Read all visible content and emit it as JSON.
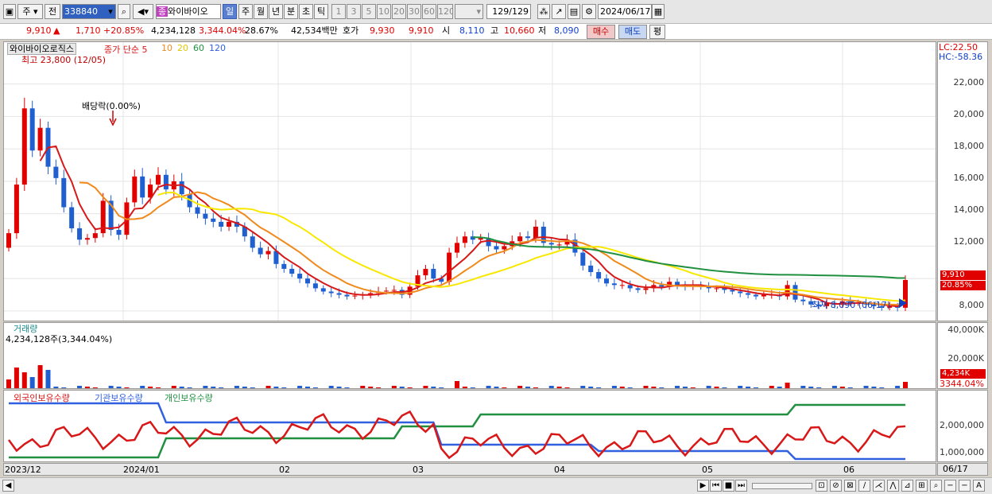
{
  "toolbar": {
    "b1": "주",
    "b2": "전",
    "code": "338840",
    "name": "와이바이오",
    "name_tag": "종",
    "periods": [
      "일",
      "주",
      "월",
      "년",
      "분",
      "초",
      "틱"
    ],
    "nums": [
      "1",
      "3",
      "5",
      "10",
      "20",
      "30",
      "60",
      "120"
    ],
    "count": "129",
    "count_total": "/129",
    "date": "2024/06/17"
  },
  "quote": {
    "price": "9,910",
    "arrow": "▲",
    "change": "1,710",
    "pct": "+20.85%",
    "volume": "4,234,128",
    "vol_pct": "3,344.04%",
    "turnover": "28.67%",
    "amount": "42,534백만",
    "hoga": "호가",
    "hoga1": "9,930",
    "hoga2": "9,910",
    "open_l": "시",
    "open": "8,110",
    "high_l": "고",
    "high": "10,660",
    "low_l": "저",
    "low": "8,090",
    "buy": "매수",
    "sell": "매도",
    "avg": "평"
  },
  "main": {
    "legend_name": "와이바이오로직스",
    "legend_close": "종가 단순 5",
    "ma": [
      "10",
      "20",
      "60",
      "120"
    ],
    "high_note": "최고 23,800 (12/05)",
    "low_note": "최저 8,090 (06/17)",
    "div_note": "배당락(0.00%)",
    "lc": "LC:22.50",
    "hc": "HC:-58.36",
    "ticks": [
      "22,000",
      "20,000",
      "18,000",
      "16,000",
      "14,000",
      "12,000",
      "9,910",
      "8,000"
    ],
    "price_tag": "9,910",
    "pct_tag": "20.85%"
  },
  "volume": {
    "title": "거래량",
    "value": "4,234,128주(3,344.04%)",
    "ticks": [
      "40,000K",
      "20,000K"
    ],
    "tag1": "4,234K",
    "tag2": "3344.04%"
  },
  "holders": {
    "legend": [
      "외국인보유수량",
      "기관보유수량",
      "개인보유수량"
    ],
    "ticks": [
      "2,000,000",
      "1,000,000"
    ]
  },
  "dates": {
    "labels": [
      "2023/12",
      "2024/01",
      "02",
      "03",
      "04",
      "05",
      "06"
    ],
    "last": "06/17"
  },
  "colors": {
    "up": "#e00000",
    "down": "#1f5fcf",
    "ma5": "#d81818",
    "ma10": "#f08a1c",
    "ma20": "#f8e800",
    "ma60": "#209040",
    "ma120": "#3060e0"
  },
  "chart_data": {
    "type": "candlestick",
    "title": "와이바이오로직스",
    "period": "daily",
    "range": [
      "2023/12",
      "2024/06/17"
    ],
    "ylim": [
      7800,
      23800
    ],
    "closes": [
      12800,
      15800,
      20500,
      17900,
      19300,
      16900,
      16200,
      14400,
      13100,
      12400,
      12500,
      12800,
      14800,
      13000,
      12700,
      14700,
      16300,
      15000,
      15800,
      16400,
      15500,
      16000,
      15200,
      14400,
      14000,
      13700,
      13500,
      13200,
      13500,
      13200,
      12600,
      11900,
      11500,
      11700,
      10900,
      10600,
      10300,
      10000,
      9700,
      9400,
      9200,
      9100,
      9000,
      8900,
      8950,
      9000,
      9100,
      9200,
      9250,
      9300,
      9000,
      9500,
      10200,
      10600,
      10000,
      9800,
      11600,
      12200,
      12600,
      12400,
      12500,
      12000,
      11800,
      12000,
      12300,
      12600,
      12500,
      13200,
      12200,
      12100,
      12100,
      12400,
      11600,
      10800,
      10400,
      10000,
      9700,
      9600,
      9600,
      9400,
      9300,
      9400,
      9600,
      9500,
      9800,
      9600,
      9500,
      9600,
      9500,
      9400,
      9400,
      9300,
      9200,
      9100,
      9000,
      8900,
      9000,
      9000,
      8900,
      9600,
      8700,
      8600,
      8400,
      8300,
      8500,
      8400,
      8600,
      8500,
      8500,
      8400,
      8300,
      8200,
      8300,
      8200,
      9910
    ],
    "volume_ratio_last": "3,344.04%",
    "ma_periods": [
      5,
      10,
      20,
      60,
      120
    ]
  }
}
